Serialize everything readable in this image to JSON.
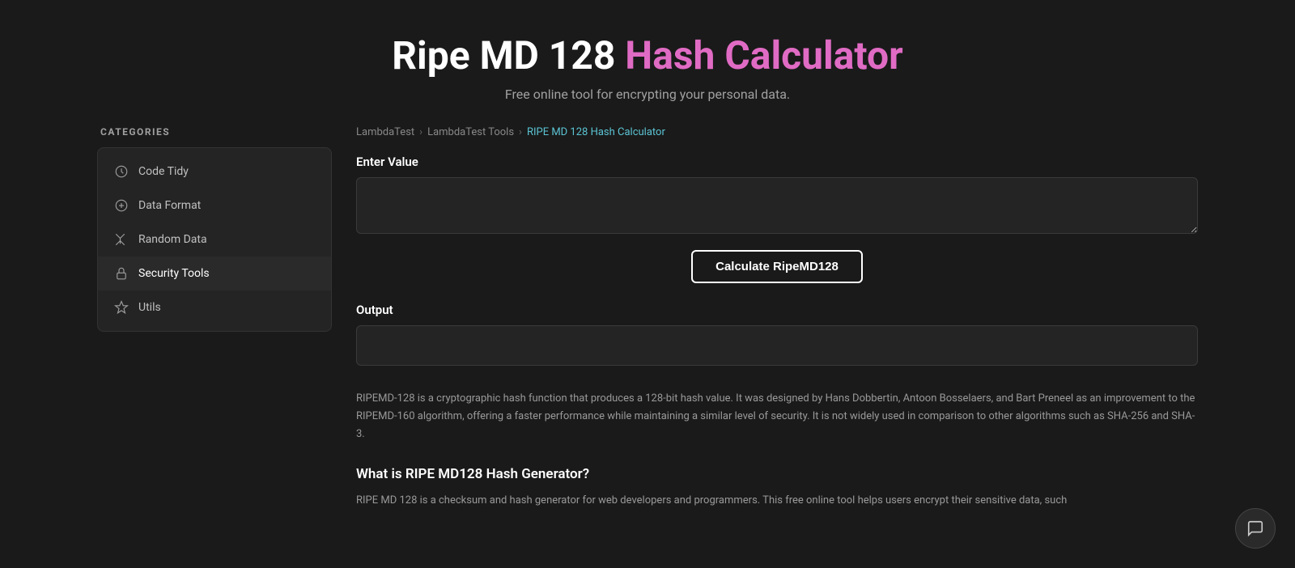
{
  "header": {
    "title_part1": "Ripe MD 128",
    "title_part2": "Hash Calculator",
    "subtitle": "Free online tool for encrypting your personal data."
  },
  "breadcrumb": {
    "items": [
      {
        "label": "LambdaTest",
        "current": false
      },
      {
        "label": "LambdaTest Tools",
        "current": false
      },
      {
        "label": "RIPE MD 128 Hash Calculator",
        "current": true
      }
    ]
  },
  "sidebar": {
    "categories_label": "CATEGORIES",
    "items": [
      {
        "label": "Code Tidy",
        "icon": "code-tidy-icon",
        "active": false
      },
      {
        "label": "Data Format",
        "icon": "data-format-icon",
        "active": false
      },
      {
        "label": "Random Data",
        "icon": "random-data-icon",
        "active": false
      },
      {
        "label": "Security Tools",
        "icon": "security-icon",
        "active": true
      },
      {
        "label": "Utils",
        "icon": "utils-icon",
        "active": false
      }
    ]
  },
  "main": {
    "enter_value_label": "Enter Value",
    "input_placeholder": "",
    "calculate_button_label": "Calculate RipeMD128",
    "output_label": "Output",
    "description": "RIPEMD-128 is a cryptographic hash function that produces a 128-bit hash value. It was designed by Hans Dobbertin, Antoon Bosselaers, and Bart Preneel as an improvement to the RIPEMD-160 algorithm, offering a faster performance while maintaining a similar level of security. It is not widely used in comparison to other algorithms such as SHA-256 and SHA-3.",
    "what_is_heading": "What is RIPE MD128 Hash Generator?",
    "what_is_text": "RIPE MD 128 is a checksum and hash generator for web developers and programmers. This free online tool helps users encrypt their sensitive data, such"
  }
}
